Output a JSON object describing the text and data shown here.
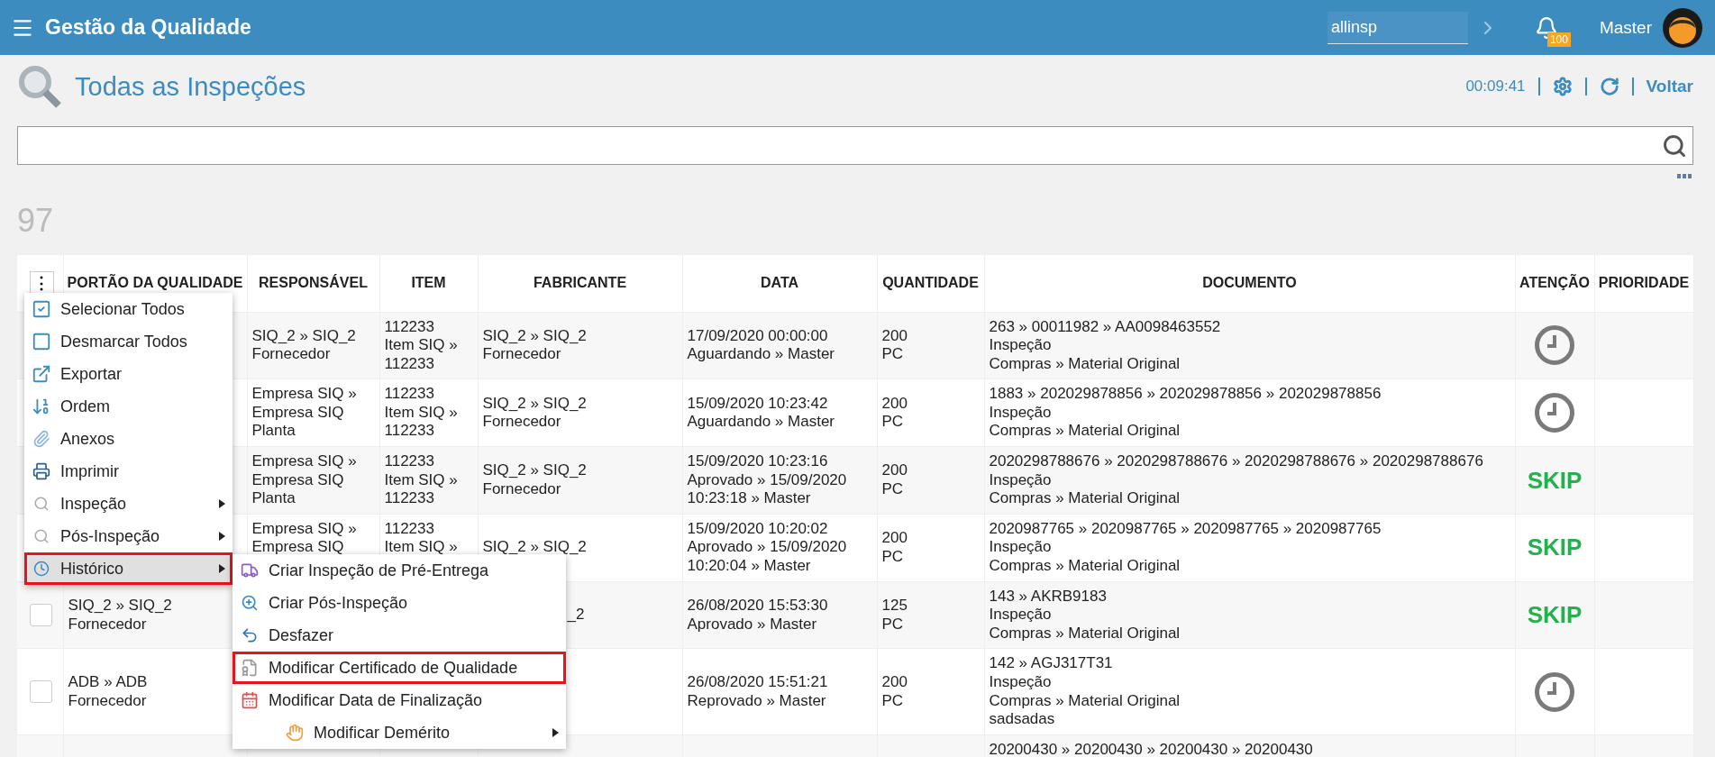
{
  "app": {
    "title": "Gestão da Qualidade",
    "search_value": "allinsp",
    "notifications": "100",
    "user": "Master"
  },
  "page": {
    "title": "Todas as Inspeções",
    "timer": "00:09:41",
    "back": "Voltar",
    "count": "97"
  },
  "table": {
    "menu_button": "⋮",
    "columns": [
      "PORTÃO DA QUALIDADE",
      "RESPONSÁVEL",
      "ITEM",
      "FABRICANTE",
      "DATA",
      "QUANTIDADE",
      "DOCUMENTO",
      "ATENÇÃO",
      "PRIORIDADE"
    ],
    "rows": [
      {
        "responsavel": "SIQ_2 » SIQ_2\nFornecedor",
        "item": "112233\nItem SIQ »\n112233",
        "fabricante": "SIQ_2 » SIQ_2\nFornecedor",
        "data": "17/09/2020 00:00:00\nAguardando » Master",
        "quantidade": "200\nPC",
        "documento": "263 » 00011982 » AA0098463552\nInspeção\nCompras » Material Original",
        "atencao": {
          "kind": "clock"
        }
      },
      {
        "responsavel": "Empresa SIQ »\nEmpresa SIQ\nPlanta",
        "item": "112233\nItem SIQ »\n112233",
        "fabricante": "SIQ_2 » SIQ_2\nFornecedor",
        "data": "15/09/2020 10:23:42\nAguardando » Master",
        "quantidade": "200\nPC",
        "documento": "1883 » 202029878856 » 202029878856 » 202029878856\nInspeção\nCompras » Material Original",
        "atencao": {
          "kind": "clock"
        }
      },
      {
        "responsavel": "Empresa SIQ »\nEmpresa SIQ\nPlanta",
        "item": "112233\nItem SIQ »\n112233",
        "fabricante": "SIQ_2 » SIQ_2\nFornecedor",
        "data": "15/09/2020 10:23:16\nAprovado » 15/09/2020\n10:23:18 » Master",
        "quantidade": "200\nPC",
        "documento": "2020298788676 » 2020298788676 » 2020298788676 » 2020298788676\nInspeção\nCompras » Material Original",
        "atencao": {
          "kind": "skip",
          "text": "SKIP"
        }
      },
      {
        "responsavel": {
          "text": "Empresa SIQ »\nEmpresa SIQ",
          "cut_bottom": true
        },
        "item": {
          "text": "112233\nItem SIQ »",
          "cut_bottom": true
        },
        "fabricante": "SIQ_2 » SIQ_2",
        "data": "15/09/2020 10:20:02\nAprovado » 15/09/2020\n10:20:04 » Master",
        "quantidade": "200\nPC",
        "documento": "2020987765 » 2020987765 » 2020987765 » 2020987765\nInspeção\nCompras » Material Original",
        "atencao": {
          "kind": "skip",
          "text": "SKIP"
        }
      },
      {
        "checked": false,
        "portao": "SIQ_2 » SIQ_2\nFornecedor",
        "fabricante": {
          "text": "_2",
          "cut_left": true
        },
        "data": "26/08/2020 15:53:30\nAprovado » Master",
        "quantidade": "125\nPC",
        "documento": "143 » AKRB9183\nInspeção\nCompras » Material Original",
        "atencao": {
          "kind": "skip",
          "text": "SKIP"
        }
      },
      {
        "checked": false,
        "portao": "ADB » ADB\nFornecedor",
        "data": "26/08/2020 15:51:21\nReprovado » Master",
        "quantidade": "200\nPC",
        "documento": "142 » AGJ317T31\nInspeção\nCompras » Material Original\nsadsadas",
        "atencao": {
          "kind": "clock"
        }
      },
      {
        "documento": "20200430 » 20200430 » 20200430 » 20200430"
      }
    ]
  },
  "menu": {
    "items": [
      {
        "label": "Selecionar Todos",
        "selected": false,
        "marked": false,
        "has_submenu": false
      },
      {
        "label": "Desmarcar Todos",
        "selected": false,
        "marked": false,
        "has_submenu": false
      },
      {
        "label": "Exportar",
        "selected": false,
        "marked": false,
        "has_submenu": false
      },
      {
        "label": "Ordem",
        "selected": false,
        "marked": false,
        "has_submenu": false
      },
      {
        "label": "Anexos",
        "selected": false,
        "marked": false,
        "has_submenu": false
      },
      {
        "label": "Imprimir",
        "selected": false,
        "marked": false,
        "has_submenu": false
      },
      {
        "label": "Inspeção",
        "selected": false,
        "marked": false,
        "has_submenu": true
      },
      {
        "label": "Pós-Inspeção",
        "selected": false,
        "marked": false,
        "has_submenu": true
      },
      {
        "label": "Histórico",
        "selected": true,
        "marked": true,
        "has_submenu": true
      }
    ]
  },
  "submenu": {
    "items": [
      {
        "label": "Criar Inspeção de Pré-Entrega",
        "selected": false,
        "marked": false,
        "has_submenu": false
      },
      {
        "label": "Criar Pós-Inspeção",
        "selected": false,
        "marked": false,
        "has_submenu": false
      },
      {
        "label": "Desfazer",
        "selected": false,
        "marked": false,
        "has_submenu": false
      },
      {
        "label": "Modificar Certificado de Qualidade",
        "selected": false,
        "marked": true,
        "has_submenu": false
      },
      {
        "label": "Modificar Data de Finalização",
        "selected": false,
        "marked": false,
        "has_submenu": false
      },
      {
        "label": "Modificar Demérito",
        "selected": false,
        "marked": false,
        "has_submenu": true
      }
    ]
  }
}
